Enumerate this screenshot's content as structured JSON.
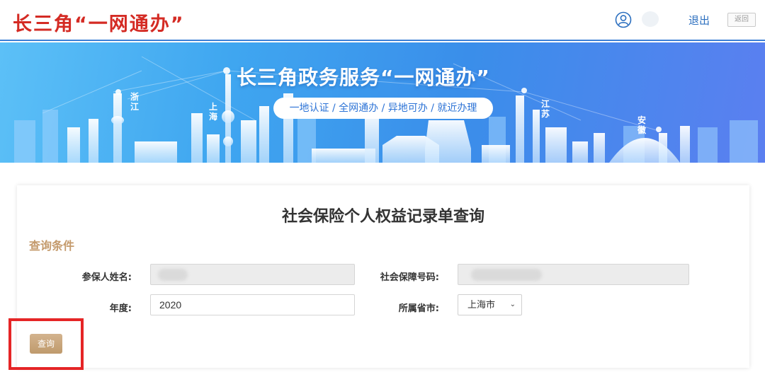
{
  "header": {
    "logo": "长三角“一网通办”",
    "logout_label": "退出",
    "back_label": "返回"
  },
  "banner": {
    "title": "长三角政务服务“一网通办”",
    "subtitle": "一地认证 / 全网通办 / 异地可办 / 就近办理",
    "regions": [
      "浙江",
      "上海",
      "江苏",
      "安徽"
    ]
  },
  "form": {
    "title": "社会保险个人权益记录单查询",
    "section_title": "查询条件",
    "name_label": "参保人姓名:",
    "ssn_label": "社会保障号码:",
    "year_label": "年度:",
    "year_value": "2020",
    "province_label": "所属省市:",
    "province_value": "上海市",
    "query_button": "查询"
  },
  "colors": {
    "logo_red": "#d42b24",
    "accent_blue": "#3c7fd6",
    "section_gold": "#c49a6c",
    "highlight_red": "#e52526"
  }
}
